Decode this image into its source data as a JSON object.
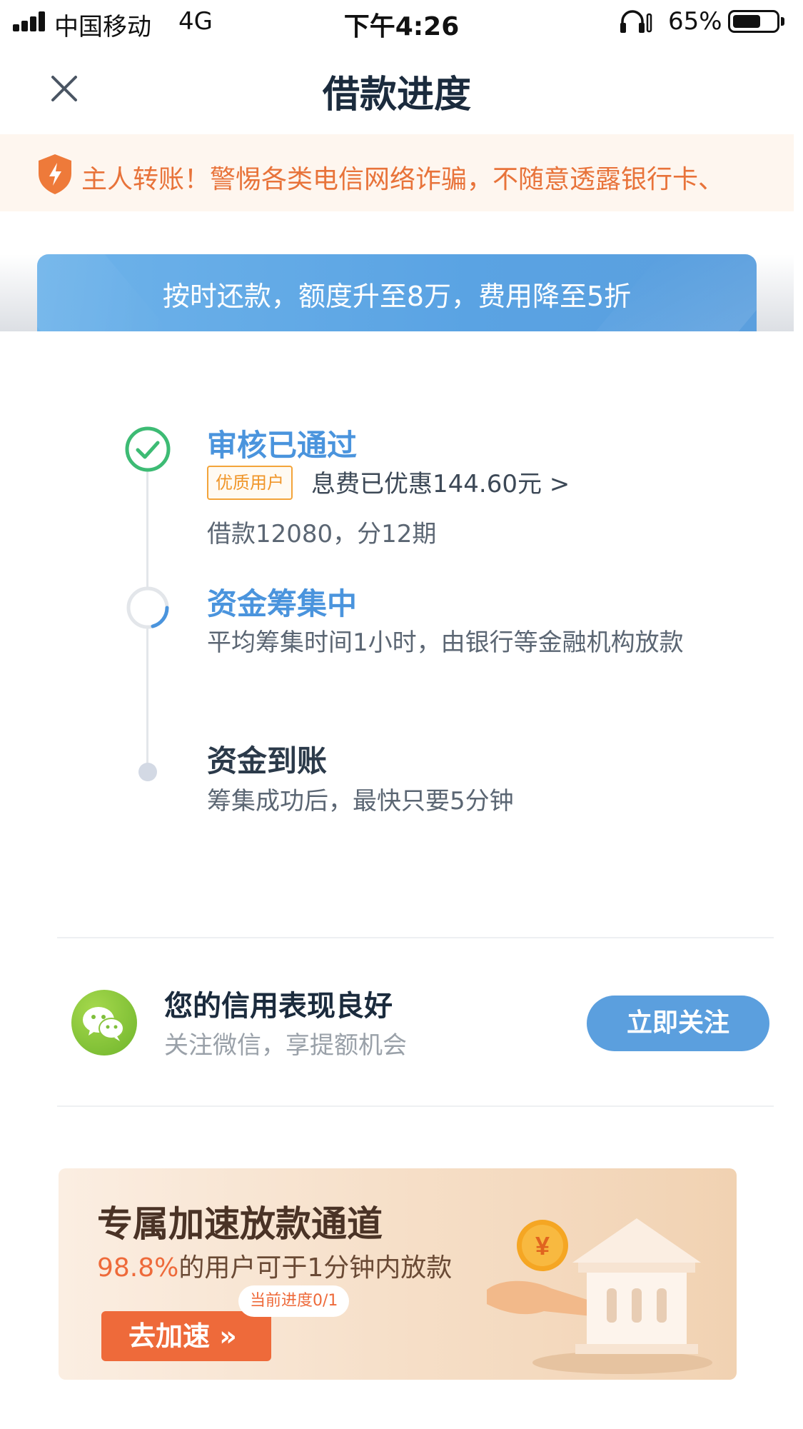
{
  "status_bar": {
    "carrier": "中国移动",
    "network": "4G",
    "time": "下午4:26",
    "battery_percent": "65%",
    "battery_level": 0.65
  },
  "header": {
    "title": "借款进度"
  },
  "warning": {
    "text": "主人转账！警惕各类电信网络诈骗，不随意透露银行卡、"
  },
  "promo_strip": {
    "text": "按时还款，额度升至8万，费用降至5折"
  },
  "timeline": {
    "steps": [
      {
        "title": "审核已通过",
        "badge": "优质用户",
        "discount": "息费已优惠144.60元 >",
        "detail": "借款12080，分12期",
        "status": "done"
      },
      {
        "title": "资金筹集中",
        "detail": "平均筹集时间1小时，由银行等金融机构放款",
        "status": "in-progress"
      },
      {
        "title": "资金到账",
        "detail": "筹集成功后，最快只要5分钟",
        "status": "pending"
      }
    ]
  },
  "wechat": {
    "title": "您的信用表现良好",
    "subtitle": "关注微信，享提额机会",
    "button": "立即关注"
  },
  "speed_card": {
    "title": "专属加速放款通道",
    "highlight": "98.8%",
    "subtitle_rest": "的用户可于1分钟内放款",
    "button": "去加速 »",
    "progress": "当前进度0/1",
    "coin_symbol": "¥"
  },
  "colors": {
    "accent_blue": "#5b9fde",
    "success_green": "#3dbb74",
    "warning_orange": "#e8733a",
    "cta_orange": "#ee6a3a"
  }
}
